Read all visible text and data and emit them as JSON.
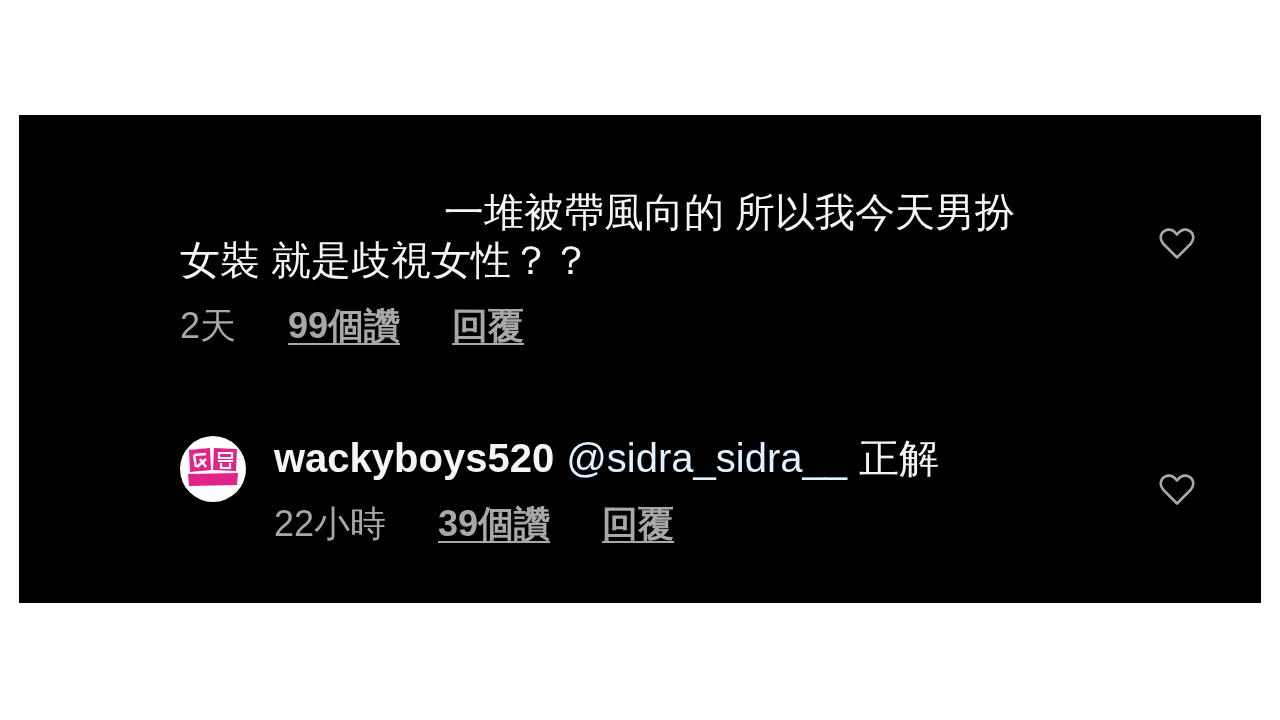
{
  "comments": [
    {
      "text_lines": [
        "一堆被帶風向的 所以我今天男扮",
        "女裝 就是歧視女性？？"
      ],
      "time": "2天",
      "likes": "99個讚",
      "reply": "回覆",
      "liked": false
    },
    {
      "username": "wackyboys520",
      "mention": "@sidra_sidra__",
      "text": "正解",
      "time": "22小時",
      "likes": "39個讚",
      "reply": "回覆",
      "liked": false
    }
  ]
}
